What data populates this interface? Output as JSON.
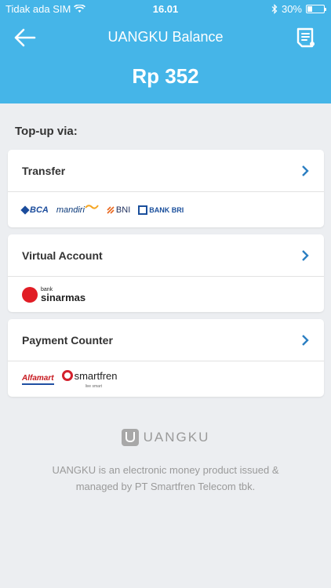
{
  "status_bar": {
    "carrier": "Tidak ada SIM",
    "time": "16.01",
    "battery": "30%",
    "battery_level": 0.3
  },
  "nav": {
    "title": "UANGKU Balance",
    "back_icon": "arrow-left-icon",
    "action_icon": "document-list-icon"
  },
  "balance": {
    "amount": "Rp 352"
  },
  "topup": {
    "label": "Top-up via:",
    "methods": [
      {
        "title": "Transfer",
        "logos": [
          "BCA",
          "mandiri",
          "BNI",
          "BANK BRI"
        ]
      },
      {
        "title": "Virtual Account",
        "logos": [
          "bank",
          "sinarmas"
        ]
      },
      {
        "title": "Payment Counter",
        "logos": [
          "Alfamart",
          "smartfren",
          "live smart"
        ]
      }
    ]
  },
  "footer": {
    "brand": "UANGKU",
    "text": "UANGKU is an electronic money product issued & managed by PT Smartfren Telecom tbk."
  },
  "colors": {
    "header": "#45b5e8",
    "chevron": "#2b7fc2",
    "background": "#eceef1"
  }
}
